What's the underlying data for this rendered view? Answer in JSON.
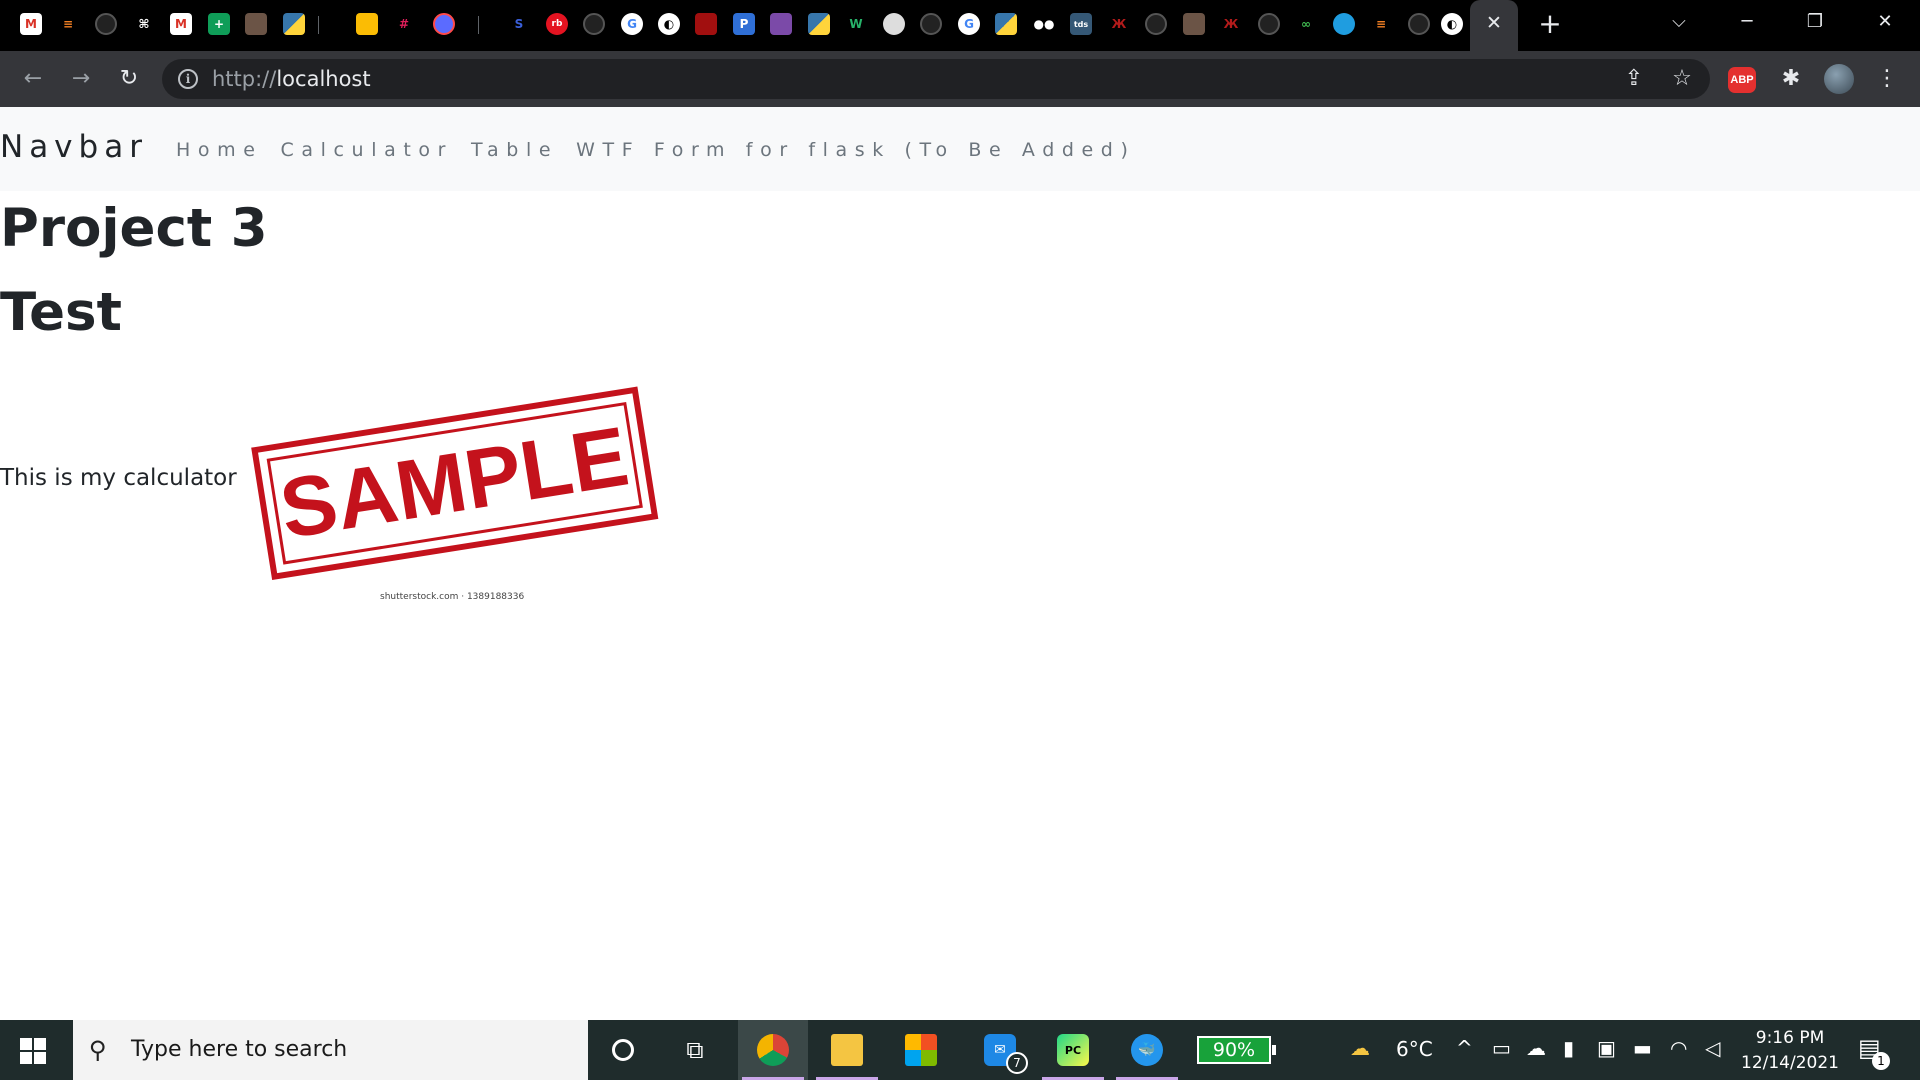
{
  "browser": {
    "active_tab_close": "✕",
    "new_tab": "+",
    "window_controls": {
      "minimize": "─",
      "restore": "❐",
      "close": "✕"
    },
    "tab_list_caret": "⌵",
    "favicons": [
      "gmail-icon",
      "stackoverflow-icon",
      "github-icon",
      "gift-icon",
      "gmail-icon",
      "google-sheets-icon",
      "avatar-icon",
      "python-icon",
      "keep-icon",
      "slack-icon",
      "app-icon",
      "s-icon",
      "redbubble-icon",
      "github-icon",
      "google-icon",
      "globe-icon",
      "red-icon",
      "p-icon",
      "purple-icon",
      "python-icon",
      "w-icon",
      "bubble-icon",
      "github-icon",
      "google-icon",
      "python-icon",
      "medium-icon",
      "tds-icon",
      "red-figure-icon",
      "github-icon",
      "avatar-icon",
      "red-figure-icon",
      "infinity-icon",
      "blue-circle-icon",
      "stackoverflow-icon",
      "github-icon",
      "globe-icon",
      "globe-icon"
    ],
    "address": {
      "scheme": "http://",
      "host": "localhost"
    },
    "extensions": {
      "abp": "ABP"
    }
  },
  "page": {
    "navbar": {
      "brand": "Navbar",
      "links": [
        "Home",
        "Calculator",
        "Table",
        "WTF Form for flask (To Be Added)"
      ]
    },
    "title": "Project 3",
    "subtitle": "Test",
    "description": "This is my calculator",
    "image": {
      "stamp_text": "SAMPLE",
      "caption": "shutterstock.com · 1389188336"
    }
  },
  "taskbar": {
    "search_placeholder": "Type here to search",
    "battery": "90%",
    "weather_temp": "6°C",
    "time": "9:16 PM",
    "date": "12/14/2021",
    "mail_badge": "7",
    "notification_count": "1"
  },
  "colors": {
    "tabstrip_bg": "#000000",
    "toolbar_bg": "#35363a",
    "omnibox_bg": "#202124",
    "navbar_bg": "#f8f9fa",
    "stamp_red": "#c4121c",
    "taskbar_bg": "#1f2c2c",
    "battery_green": "#18a23a"
  }
}
